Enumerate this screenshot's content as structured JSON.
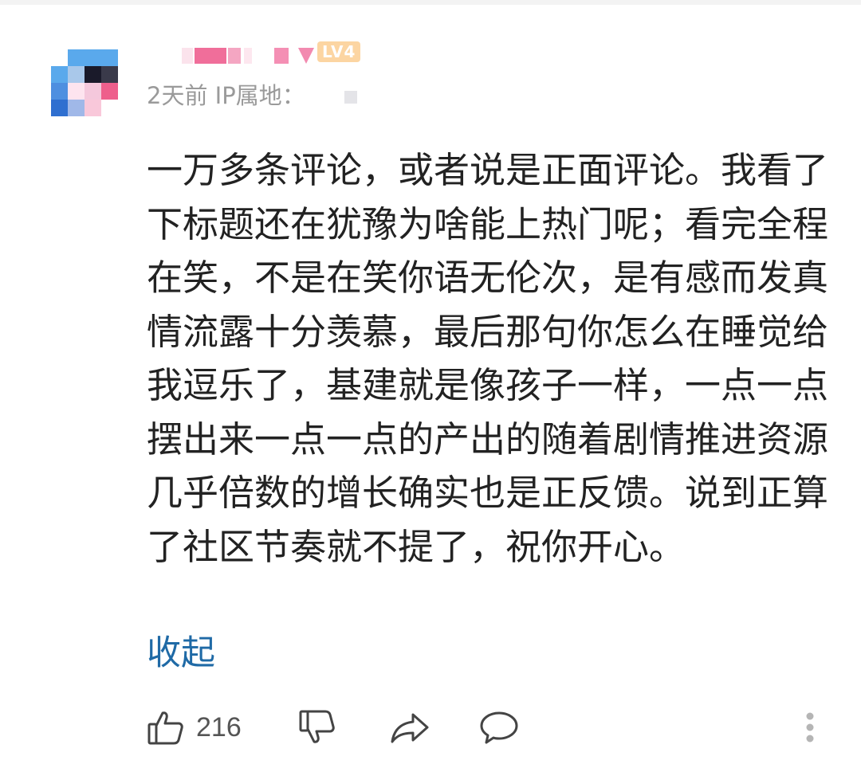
{
  "user": {
    "level_badge": "LV4",
    "avatar_icon": "pixelated-avatar"
  },
  "meta": {
    "time": "2天前",
    "ip_label": "IP属地："
  },
  "comment": {
    "text": "一万多条评论，或者说是正面评论。我看了下标题还在犹豫为啥能上热门呢；看完全程在笑，不是在笑你语无伦次，是有感而发真情流露十分羡慕，最后那句你怎么在睡觉给我逗乐了，基建就是像孩子一样，一点一点摆出来一点一点的产出的随着剧情推进资源几乎倍数的增长确实也是正反馈。说到正算了社区节奏就不提了，祝你开心。",
    "collapse_label": "收起"
  },
  "actions": {
    "like_count": "216",
    "icons": [
      "thumbs-up-icon",
      "thumbs-down-icon",
      "share-icon",
      "comment-icon",
      "more-icon"
    ]
  },
  "colors": {
    "text": "#222222",
    "meta": "#9a9a9a",
    "link": "#1f6aa6",
    "badge": "#fcd5a2",
    "icon": "#444444"
  }
}
